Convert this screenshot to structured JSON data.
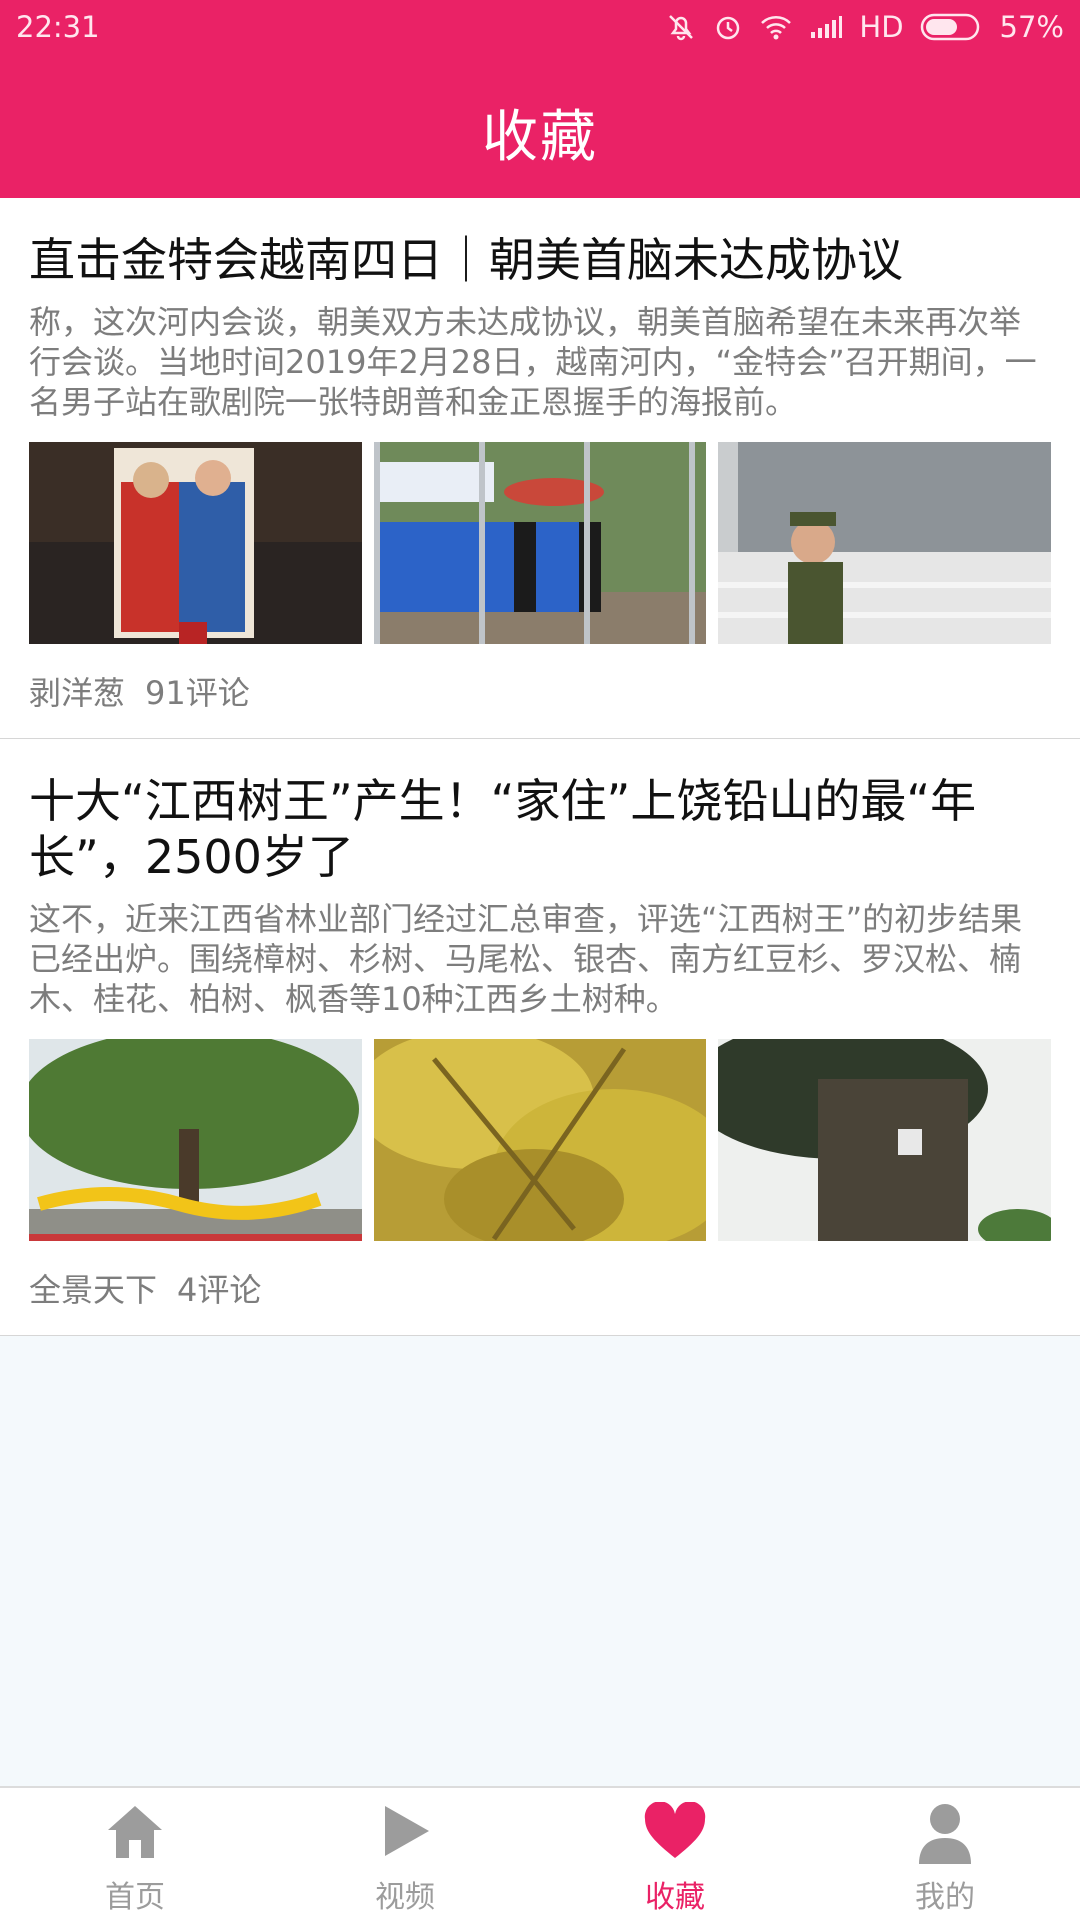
{
  "status_bar": {
    "time": "22:31",
    "network": "HD",
    "battery": "57%"
  },
  "header": {
    "title": "收藏"
  },
  "articles": [
    {
      "title": "直击金特会越南四日｜朝美首脑未达成协议",
      "summary": "称，这次河内会谈，朝美双方未达成协议，朝美首脑希望在未来再次举行会谈。当地时间2019年2月28日，越南河内，“金特会”召开期间，一名男子站在歌剧院一张特朗普和金正恩握手的海报前。",
      "source": "剥洋葱",
      "comments": "91评论"
    },
    {
      "title": "十大“江西树王”产生！“家住”上饶铅山的最“年长”，2500岁了",
      "summary": "这不，近来江西省林业部门经过汇总审查，评选“江西树王”的初步结果已经出炉。围绕樟树、杉树、马尾松、银杏、南方红豆杉、罗汉松、楠木、桂花、柏树、枫香等10种江西乡土树种。",
      "source": "全景天下",
      "comments": "4评论"
    }
  ],
  "nav": {
    "items": [
      {
        "label": "首页",
        "icon": "home-icon"
      },
      {
        "label": "视频",
        "icon": "play-icon"
      },
      {
        "label": "收藏",
        "icon": "heart-icon"
      },
      {
        "label": "我的",
        "icon": "user-icon"
      }
    ],
    "active_index": 2
  },
  "colors": {
    "accent": "#ea2266",
    "inactive": "#9c9c9c",
    "background": "#f4f9fc"
  }
}
